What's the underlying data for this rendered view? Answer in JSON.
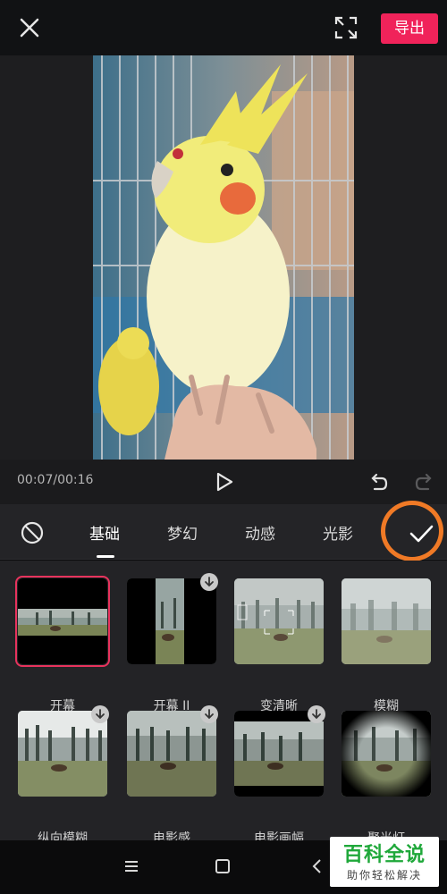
{
  "header": {
    "export_label": "导出"
  },
  "player": {
    "timecode": "00:07/00:16"
  },
  "tabs": [
    {
      "label": "基础",
      "active": true
    },
    {
      "label": "梦幻",
      "active": false
    },
    {
      "label": "动感",
      "active": false
    },
    {
      "label": "光影",
      "active": false
    }
  ],
  "effects": [
    {
      "label": "开幕",
      "selected": true,
      "download": false
    },
    {
      "label": "开幕 II",
      "selected": false,
      "download": true
    },
    {
      "label": "变清晰",
      "selected": false,
      "download": false
    },
    {
      "label": "模糊",
      "selected": false,
      "download": false
    },
    {
      "label": "纵向模糊",
      "selected": false,
      "download": true
    },
    {
      "label": "电影感",
      "selected": false,
      "download": true
    },
    {
      "label": "电影画幅",
      "selected": false,
      "download": true
    },
    {
      "label": "聚光灯",
      "selected": false,
      "download": false
    }
  ],
  "watermark": {
    "title": "百科全说",
    "subtitle": "助你轻松解决"
  },
  "colors": {
    "accent": "#f0235a",
    "selection": "#e7335d",
    "annotation": "#f07a26",
    "watermark_green": "#1fa83a"
  },
  "icons": [
    "close-icon",
    "fullscreen-icon",
    "play-icon",
    "undo-icon",
    "redo-icon",
    "no-effect-icon",
    "checkmark-icon",
    "download-icon",
    "menu-icon",
    "home-icon",
    "back-icon"
  ]
}
